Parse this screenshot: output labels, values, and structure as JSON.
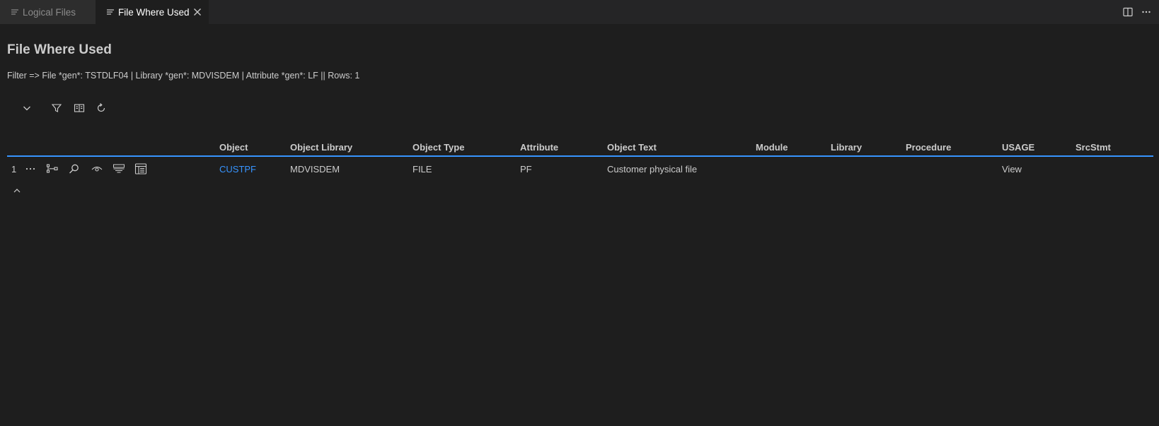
{
  "tabs": [
    {
      "label": "Logical Files",
      "icon": "list-icon",
      "active": false
    },
    {
      "label": "File Where Used",
      "icon": "list-icon",
      "active": true
    }
  ],
  "editor_actions": [
    "split-editor-icon",
    "more-actions-icon"
  ],
  "page": {
    "title": "File Where Used",
    "filter_text": "Filter => File *gen*: TSTDLF04 | Library *gen*: MDVISDEM | Attribute *gen*: LF || Rows: 1"
  },
  "toolbar": [
    "chevron-down-icon",
    "filter-icon",
    "columns-icon",
    "refresh-icon"
  ],
  "table": {
    "columns": [
      "Object",
      "Object Library",
      "Object Type",
      "Attribute",
      "Object Text",
      "Module",
      "Library",
      "Procedure",
      "USAGE",
      "SrcStmt"
    ],
    "rows": [
      {
        "index": "1",
        "object": "CUSTPF",
        "object_library": "MDVISDEM",
        "object_type": "FILE",
        "attribute": "PF",
        "object_text": "Customer physical file",
        "module": "",
        "library": "",
        "procedure": "",
        "usage": "View",
        "srcstmt": ""
      }
    ]
  },
  "colors": {
    "accent": "#3794ff",
    "background": "#1e1e1e",
    "tabbar": "#252526"
  }
}
